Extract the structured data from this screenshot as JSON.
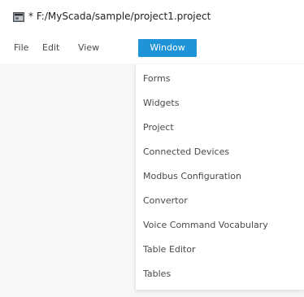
{
  "window": {
    "title": "* F:/MyScada/sample/project1.project"
  },
  "menu": {
    "file_label": "File",
    "edit_label": "Edit",
    "view_label": "View",
    "window_label": "Window",
    "active_color": "#1f94d8"
  },
  "window_menu": {
    "items": [
      {
        "label": "Forms"
      },
      {
        "label": "Widgets"
      },
      {
        "label": "Project"
      },
      {
        "label": "Connected Devices"
      },
      {
        "label": "Modbus Configuration"
      },
      {
        "label": "Convertor"
      },
      {
        "label": "Voice Command Vocabulary"
      },
      {
        "label": "Table Editor"
      },
      {
        "label": "Tables"
      }
    ]
  },
  "icons": {
    "app": "app-window-icon"
  }
}
